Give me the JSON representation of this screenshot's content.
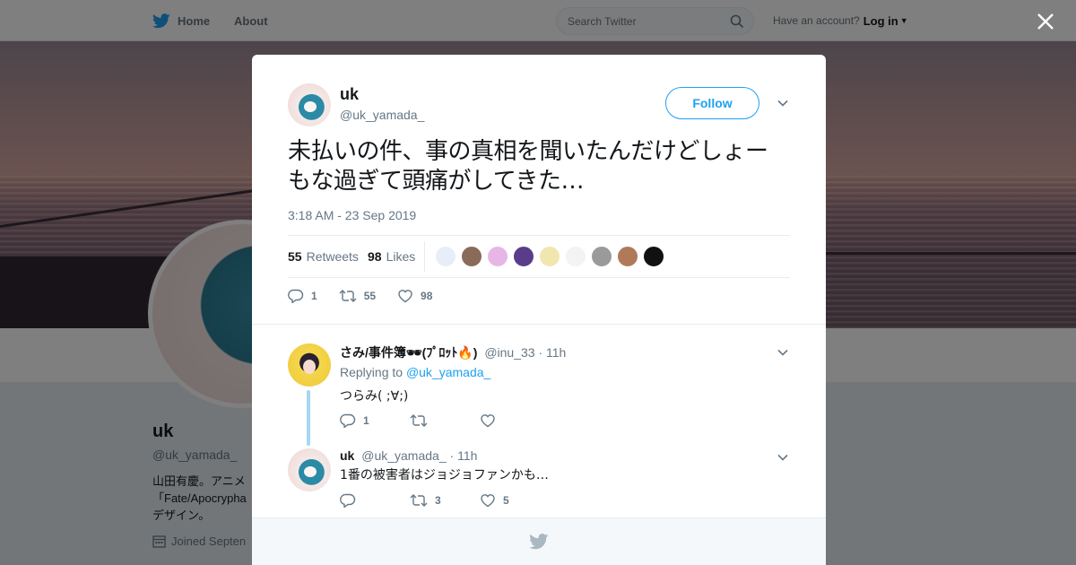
{
  "nav": {
    "home_label": "Home",
    "about_label": "About",
    "search_placeholder": "Search Twitter",
    "account_prompt": "Have an account?",
    "login_label": "Log in"
  },
  "background_profile": {
    "name": "uk",
    "handle": "@uk_yamada_",
    "bio": "山田有慶。アニメ\n「Fate/Apocrypha\nデザイン。",
    "joined": "Joined Septen"
  },
  "tweet": {
    "author_name": "uk",
    "author_handle": "@uk_yamada_",
    "follow_label": "Follow",
    "text": "未払いの件、事の真相を聞いたんだけどしょーもな過ぎて頭痛がしてきた…",
    "timestamp": "3:18 AM - 23 Sep 2019",
    "retweets_count": "55",
    "retweets_label": "Retweets",
    "likes_count": "98",
    "likes_label": "Likes",
    "actions": {
      "reply_count": "1",
      "retweet_count": "55",
      "like_count": "98"
    },
    "likers": [
      {
        "color": "#e8eef8"
      },
      {
        "color": "#8a6a5a"
      },
      {
        "color": "#e7b6e6"
      },
      {
        "color": "#5a3d8a"
      },
      {
        "color": "#f2e6b0"
      },
      {
        "color": "#f3f3f3"
      },
      {
        "color": "#9a9a9a"
      },
      {
        "color": "#b07a5a"
      },
      {
        "color": "#111111"
      }
    ]
  },
  "replies": [
    {
      "name": "さみ/事件簿🕶(ﾌﾟﾛｯﾄ🔥)",
      "handle": "@inu_33",
      "time": "· 11h",
      "replying_prefix": "Replying to",
      "replying_to": "@uk_yamada_",
      "text": "つらみ( ;∀;)",
      "reply_count": "1",
      "retweet_count": "",
      "like_count": ""
    },
    {
      "name": "uk",
      "handle": "@uk_yamada_",
      "time": "· 11h",
      "text": "1番の被害者はジョジョファンかも…",
      "reply_count": "",
      "retweet_count": "3",
      "like_count": "5"
    }
  ],
  "colors": {
    "brand": "#1da1f2",
    "text": "#14171a",
    "muted": "#657786",
    "thread_line": "#a6d7f7"
  }
}
